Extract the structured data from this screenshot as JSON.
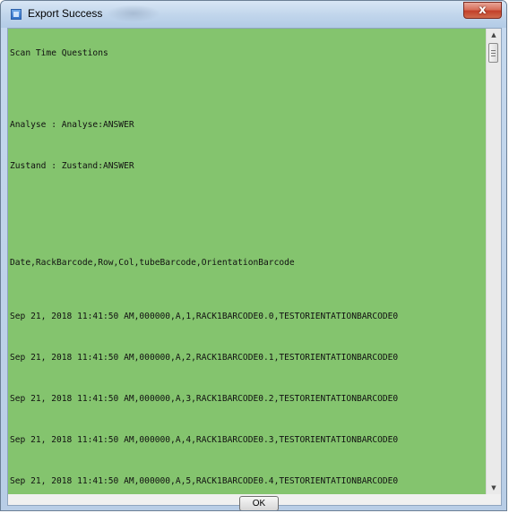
{
  "window": {
    "title": "Export Success",
    "close_label": "x"
  },
  "content": {
    "lines": [
      "Scan Time Questions",
      "Analyse : Analyse:ANSWER",
      "Zustand : Zustand:ANSWER",
      "Date,RackBarcode,Row,Col,tubeBarcode,OrientationBarcode",
      "Sep 21, 2018 11:41:50 AM,000000,A,1,RACK1BARCODE0.0,TESTORIENTATIONBARCODE0",
      "Sep 21, 2018 11:41:50 AM,000000,A,2,RACK1BARCODE0.1,TESTORIENTATIONBARCODE0",
      "Sep 21, 2018 11:41:50 AM,000000,A,3,RACK1BARCODE0.2,TESTORIENTATIONBARCODE0",
      "Sep 21, 2018 11:41:50 AM,000000,A,4,RACK1BARCODE0.3,TESTORIENTATIONBARCODE0",
      "Sep 21, 2018 11:41:50 AM,000000,A,5,RACK1BARCODE0.4,TESTORIENTATIONBARCODE0"
    ],
    "background_color": "#84c46e"
  },
  "footer": {
    "ok_label": "OK"
  },
  "icons": {
    "app": "application-icon",
    "close": "close-icon",
    "scroll_up": "scroll-up-arrow-icon",
    "scroll_down": "scroll-down-arrow-icon"
  }
}
